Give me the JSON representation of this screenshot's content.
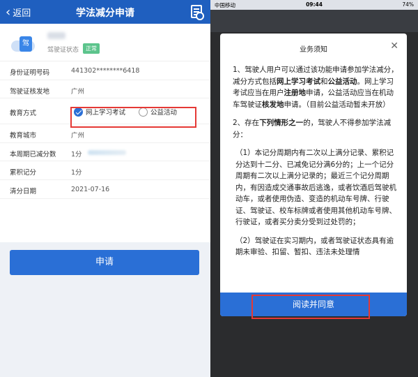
{
  "left": {
    "nav": {
      "back_label": "返回",
      "title": "学法减分申请",
      "action_icon": "document-icon"
    },
    "profile": {
      "avatar_letter": "驾",
      "license_status_label": "驾驶证状态",
      "license_status_tag": "正常"
    },
    "fields": [
      {
        "label": "身份证明号码",
        "value": "441302********6418"
      },
      {
        "label": "驾驶证核发地",
        "value": "广州"
      }
    ],
    "education": {
      "label": "教育方式",
      "options": [
        {
          "label": "网上学习考试",
          "selected": true
        },
        {
          "label": "公益活动",
          "selected": false
        }
      ]
    },
    "fields2": [
      {
        "label": "教育城市",
        "value": "广州"
      },
      {
        "label": "本周期已减分数",
        "value": "1分"
      },
      {
        "label": "累积记分",
        "value": "1分"
      },
      {
        "label": "清分日期",
        "value": "2021-07-16"
      }
    ],
    "apply_button": "申请"
  },
  "right": {
    "status": {
      "carrier": "中国移动",
      "time": "09:44",
      "battery": "74%"
    },
    "modal": {
      "title": "业务须知",
      "close_icon": "close-icon",
      "para1_a": "1、驾驶人用户可以通过该功能申请参加学法减分，减分方式包括",
      "para1_b1": "网上学习考试",
      "para1_c": "和",
      "para1_b2": "公益活动",
      "para1_d": "。网上学习考试应当在用户",
      "para1_b3": "注册地",
      "para1_e": "申请，公益活动应当在机动车驾驶证",
      "para1_b4": "核发地",
      "para1_f": "申请。（目前公益活动暂未开放）",
      "para2_a": "2、存在",
      "para2_b": "下列情形之一",
      "para2_c": "的，驾驶人不得参加学法减分：",
      "para3": "（1）本记分周期内有二次以上满分记录、累积记分达到十二分、已减免记分满6分的；上一个记分周期有二次以上满分记录的；最近三个记分周期内，有因造成交通事故后逃逸，或者饮酒后驾驶机动车，或者使用伪造、变造的机动车号牌、行驶证、驾驶证、校车标牌或者使用其他机动车号牌、行驶证，或者买分卖分受到过处罚的；",
      "para4": "（2）驾驶证在实习期内，或者驾驶证状态具有逾期未审验、扣留、暂扣、违法未处理情",
      "agree_button": "阅读并同意"
    }
  }
}
